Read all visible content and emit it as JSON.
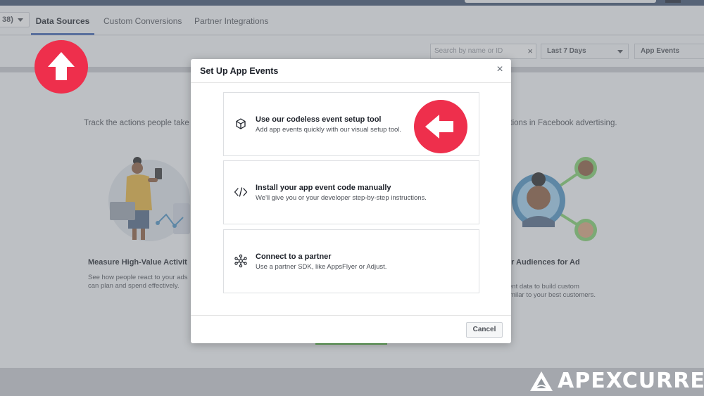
{
  "topbar": {},
  "account": {
    "label": "38)"
  },
  "tabs": [
    {
      "label": "Data Sources",
      "active": true
    },
    {
      "label": "Custom Conversions",
      "active": false
    },
    {
      "label": "Partner Integrations",
      "active": false
    }
  ],
  "filters": {
    "search_placeholder": "Search by name or ID",
    "clear_glyph": "×",
    "date_range": "Last 7 Days",
    "event_type": "App Events"
  },
  "background": {
    "intro_left": "Track the actions people take o",
    "intro_right": "ations in Facebook advertising.",
    "left_card": {
      "title": "Measure High-Value Activit",
      "text_1": "See how people react to your ads",
      "text_2": "can plan and spend effectively."
    },
    "right_card": {
      "title": "er Audiences for Ad",
      "text_1": "ent data to build custom",
      "text_2": "imilar to your best customers."
    }
  },
  "modal": {
    "title": "Set Up App Events",
    "close_glyph": "×",
    "options": [
      {
        "title": "Use our codeless event setup tool",
        "description": "Add app events quickly with our visual setup tool.",
        "icon": "cube-icon"
      },
      {
        "title": "Install your app event code manually",
        "description": "We'll give you or your developer step-by-step instructions.",
        "icon": "code-icon"
      },
      {
        "title": "Connect to a partner",
        "description": "Use a partner SDK, like AppsFlyer or Adjust.",
        "icon": "network-icon"
      }
    ],
    "cancel_label": "Cancel"
  },
  "annotations": {
    "color": "#ee2f4c",
    "arrows": [
      "up-arrow-icon",
      "left-arrow-icon"
    ]
  },
  "watermark": {
    "brand_text": "APEXCURRENT",
    "icon": "apex-logo-icon"
  },
  "colors": {
    "accent": "#4267b2",
    "cta_green": "#42b72a"
  }
}
